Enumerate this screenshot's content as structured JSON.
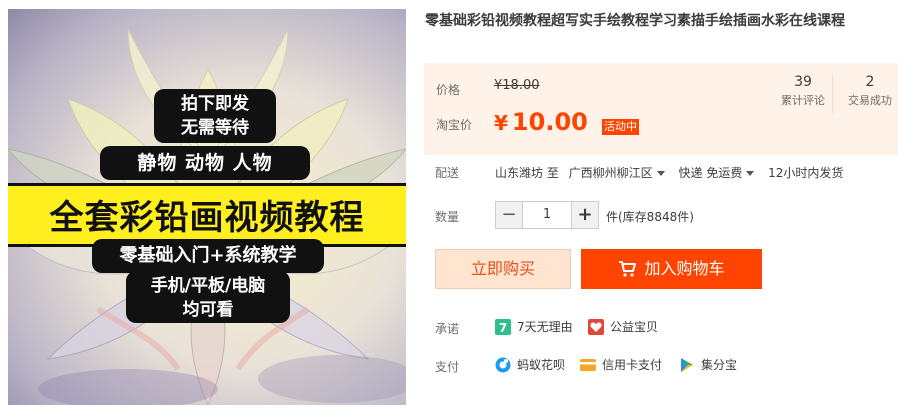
{
  "product": {
    "title": "零基础彩铅视频教程超写实手绘教程学习素描手绘插画水彩在线课程",
    "image": {
      "badge_top_1": "拍下即发",
      "badge_top_2": "无需等待",
      "badge_sub": "静物 动物 人物",
      "badge_main": "全套彩铅画视频教程",
      "badge_line1": "零基础入门+系统教学",
      "badge_bottom_1": "手机/平板/电脑",
      "badge_bottom_2": "均可看"
    }
  },
  "price": {
    "label": "价格",
    "original": "¥18.00",
    "promo_label": "淘宝价",
    "promo_currency": "¥",
    "promo_value": "10.00",
    "promo_tag": "活动中"
  },
  "stats": {
    "reviews_count": "39",
    "reviews_label": "累计评论",
    "deals_count": "2",
    "deals_label": "交易成功"
  },
  "delivery": {
    "label": "配送",
    "from": "山东潍坊 至",
    "to": "广西柳州柳江区",
    "shipping": "快递 免运费",
    "dispatch": "12小时内发货"
  },
  "quantity": {
    "label": "数量",
    "value": "1",
    "minus": "−",
    "plus": "+",
    "stock": "件(库存8848件)"
  },
  "actions": {
    "buy_now": "立即购买",
    "add_to_cart": "加入购物车"
  },
  "promise": {
    "label": "承诺",
    "items": [
      "7天无理由",
      "公益宝贝"
    ]
  },
  "payment": {
    "label": "支付",
    "items": [
      "蚂蚁花呗",
      "信用卡支付",
      "集分宝"
    ]
  },
  "colors": {
    "accent": "#ff4400",
    "price_panel": "#fff2e8",
    "buy_button_bg": "#ffe4d0",
    "badge_yellow": "#ffef1e"
  }
}
